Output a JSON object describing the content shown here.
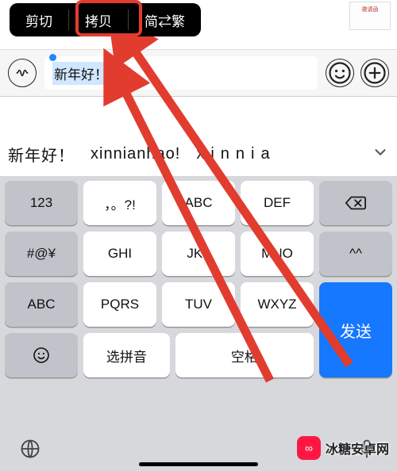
{
  "context_menu": {
    "cut": "剪切",
    "copy": "拷贝",
    "simp_trad": "简⇄繁"
  },
  "input": {
    "selected_text": "新年好！"
  },
  "candidates": {
    "c1": "新年好！",
    "c2": "xinnianhao!",
    "c3": "xinnia"
  },
  "keys": {
    "r1": {
      "k1": "123",
      "k2": "，。?!",
      "k3": "ABC",
      "k4": "DEF"
    },
    "r2": {
      "k1": "#@¥",
      "k2": "GHI",
      "k3": "JKL",
      "k4": "MNO",
      "k5": "^^"
    },
    "r3": {
      "k1": "ABC",
      "k2": "PQRS",
      "k3": "TUV",
      "k4": "WXYZ"
    },
    "r4": {
      "k2": "选拼音",
      "k3": "空格"
    },
    "send": "发送"
  },
  "thumb_label": "邀请函",
  "watermark": "冰糖安卓网"
}
